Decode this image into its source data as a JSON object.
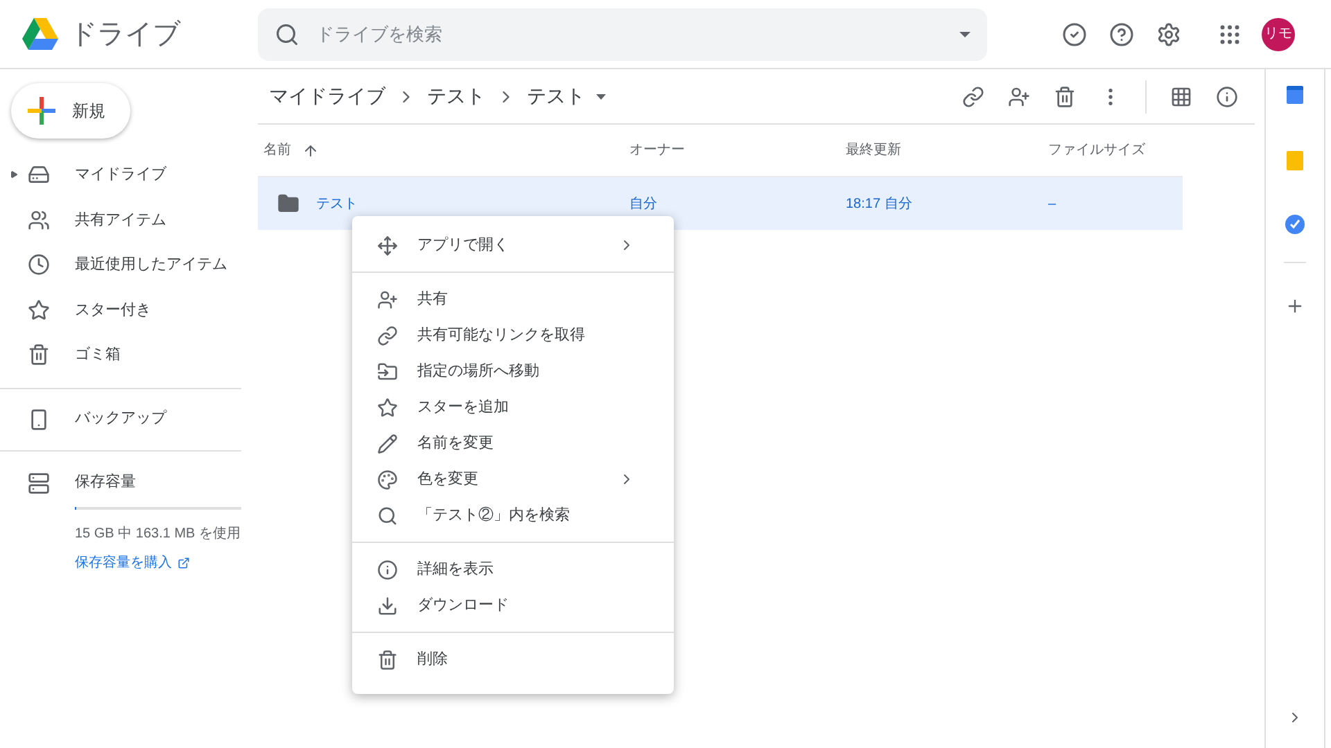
{
  "app": {
    "title": "ドライブ"
  },
  "search": {
    "placeholder": "ドライブを検索"
  },
  "account": {
    "initials": "リモ"
  },
  "new_button": {
    "label": "新規"
  },
  "sidebar": {
    "items": [
      {
        "label": "マイドライブ",
        "has_caret": true
      },
      {
        "label": "共有アイテム",
        "has_caret": false
      },
      {
        "label": "最近使用したアイテム",
        "has_caret": false
      },
      {
        "label": "スター付き",
        "has_caret": false
      },
      {
        "label": "ゴミ箱",
        "has_caret": false
      }
    ],
    "backup": {
      "label": "バックアップ"
    },
    "storage": {
      "label": "保存容量",
      "level": 0.011,
      "usage": "15 GB 中 163.1 MB を使用",
      "buy_link": "保存容量を購入"
    }
  },
  "breadcrumb": [
    "マイドライブ",
    "テスト",
    "テスト"
  ],
  "table": {
    "columns": [
      "名前",
      "オーナー",
      "最終更新",
      "ファイルサイズ"
    ],
    "rows": [
      {
        "name": "テスト",
        "owner": "自分",
        "modified": "18:17 自分",
        "size": "–",
        "selected": true
      }
    ]
  },
  "context_menu": {
    "groups": [
      [
        {
          "label": "アプリで開く",
          "submenu": true
        }
      ],
      [
        {
          "label": "共有",
          "submenu": false
        },
        {
          "label": "共有可能なリンクを取得",
          "submenu": false
        },
        {
          "label": "指定の場所へ移動",
          "submenu": false
        },
        {
          "label": "スターを追加",
          "submenu": false
        },
        {
          "label": "名前を変更",
          "submenu": false
        },
        {
          "label": "色を変更",
          "submenu": true
        },
        {
          "label": "「テスト②」内を検索",
          "submenu": false
        }
      ],
      [
        {
          "label": "詳細を表示",
          "submenu": false
        },
        {
          "label": "ダウンロード",
          "submenu": false
        }
      ],
      [
        {
          "label": "削除",
          "submenu": false
        }
      ]
    ]
  }
}
